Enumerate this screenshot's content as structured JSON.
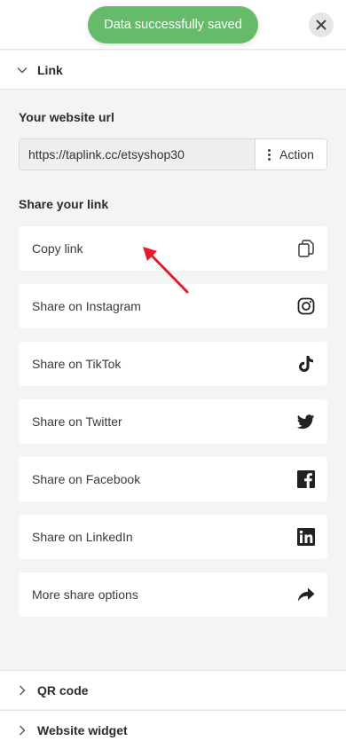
{
  "toast": {
    "message": "Data successfully saved"
  },
  "sections": {
    "link": {
      "title": "Link"
    },
    "qr": {
      "title": "QR code"
    },
    "widget": {
      "title": "Website widget"
    }
  },
  "url": {
    "label": "Your website url",
    "value": "https://taplink.cc/etsyshop30",
    "action_label": "Action"
  },
  "share": {
    "heading": "Share your link",
    "items": [
      {
        "label": "Copy link",
        "icon": "copy-icon"
      },
      {
        "label": "Share on Instagram",
        "icon": "instagram-icon"
      },
      {
        "label": "Share on TikTok",
        "icon": "tiktok-icon"
      },
      {
        "label": "Share on Twitter",
        "icon": "twitter-icon"
      },
      {
        "label": "Share on Facebook",
        "icon": "facebook-icon"
      },
      {
        "label": "Share on LinkedIn",
        "icon": "linkedin-icon"
      },
      {
        "label": "More share options",
        "icon": "share-arrow-icon"
      }
    ]
  },
  "colors": {
    "toast_bg": "#66bb6a",
    "annotation_arrow": "#e8192c"
  }
}
